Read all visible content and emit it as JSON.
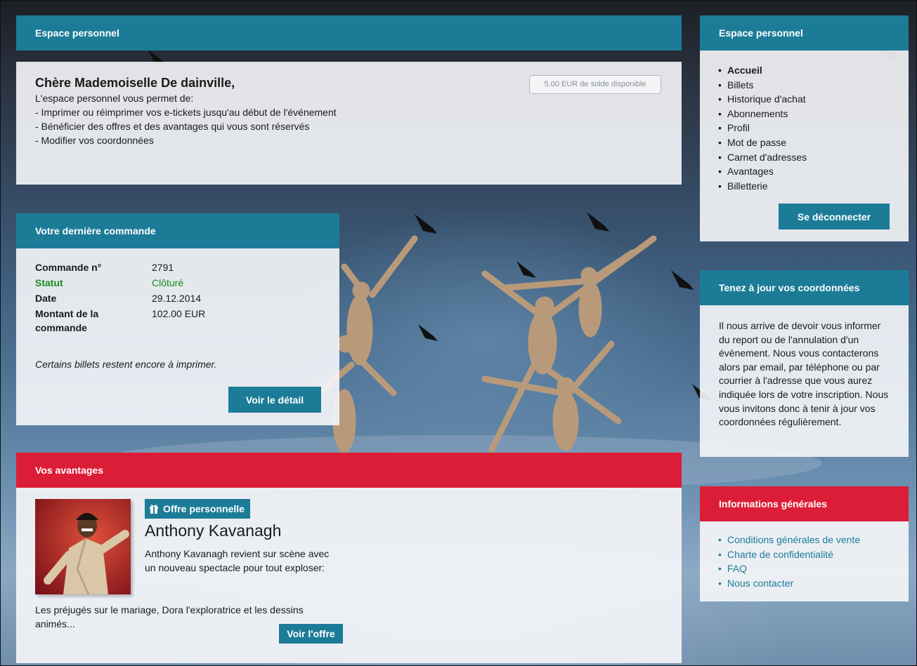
{
  "main_header": {
    "title": "Espace personnel"
  },
  "welcome": {
    "greeting": "Chère Mademoiselle De dainville,",
    "balance": "5.00 EUR de solde disponible",
    "lines": [
      "L'espace personnel vous permet de:",
      "- Imprimer ou réimprimer vos e-tickets jusqu'au début de l'événement",
      "- Bénéficier des offres et des avantages qui vous sont réservés",
      "- Modifier vos coordonnées"
    ]
  },
  "order": {
    "title": "Votre dernière commande",
    "rows": [
      {
        "label": "Commande n°",
        "value": "2791"
      },
      {
        "label": "Statut",
        "value": "Clôturé"
      },
      {
        "label": "Date",
        "value": "29.12.2014"
      },
      {
        "label": "Montant de la commande",
        "value": "102.00 EUR"
      }
    ],
    "note": "Certains billets restent encore à imprimer.",
    "detail_button": "Voir le détail"
  },
  "advantages": {
    "title": "Vos avantages",
    "badge": "Offre personnelle",
    "offer_title": "Anthony Kavanagh",
    "offer_text": "Anthony Kavanagh revient sur scène avec un nouveau spectacle pour tout exploser:",
    "offer_text2": "Les préjugés sur le mariage, Dora l'exploratrice et les dessins animés...",
    "offer_button": "Voir l'offre"
  },
  "sidebar_account": {
    "title": "Espace personnel",
    "items": [
      "Accueil",
      "Billets",
      "Historique d'achat",
      "Abonnements",
      "Profil",
      "Mot de passe",
      "Carnet d'adresses",
      "Avantages",
      "Billetterie"
    ],
    "logout_button": "Se déconnecter"
  },
  "sidebar_update": {
    "title": "Tenez à jour vos coordonnées",
    "text": "Il nous arrive de devoir vous informer du report ou de l'annulation d'un évènement. Nous vous contacterons alors par email, par téléphone ou par courrier à l'adresse que vous aurez indiquée lors de votre inscription. Nous vous invitons donc à tenir à jour vos coordonnées régulièrement."
  },
  "sidebar_info": {
    "title": "Informations générales",
    "links": [
      "Conditions générales de vente",
      "Charte de confidentialité",
      "FAQ",
      "Nous contacter"
    ]
  },
  "colors": {
    "primary": "#1c7c98",
    "accent_red": "#dc1d37",
    "status_green": "#1a8a1a"
  },
  "icons": {
    "offer_badge": "gift-icon"
  }
}
